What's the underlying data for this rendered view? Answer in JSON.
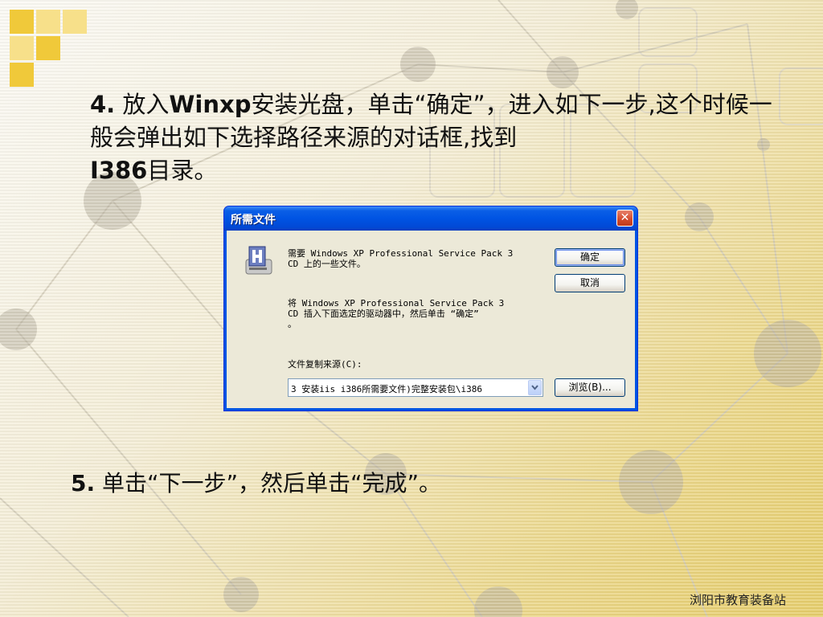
{
  "slide": {
    "step4": {
      "num": "4.",
      "t1": " 放入",
      "t2": "Winxp",
      "t3": "安装光盘，单击“确定”，进入如下一步,这个时候一般会弹出如下选择路径来源的对话框,找到",
      "t4": "I386",
      "t5": "目录。"
    },
    "step5": {
      "num": "5.",
      "text": " 单击“下一步”，然后单击“完成”。"
    },
    "footer": "浏阳市教育装备站"
  },
  "dialog": {
    "title": "所需文件",
    "close": "✕",
    "message1": "需要 Windows XP Professional Service Pack 3\nCD 上的一些文件。",
    "message2": "将 Windows XP Professional Service Pack 3\nCD 插入下面选定的驱动器中，然后单击 “确定”\n。",
    "source_label": "文件复制来源(C):",
    "source_value": "3 安装iis i386所需要文件)完整安装包\\i386",
    "ok_label": "确定",
    "cancel_label": "取消",
    "browse_label": "浏览(B)..."
  },
  "colors": {
    "tile_dark": "#f0c93a",
    "tile_light": "#f7e08a",
    "titlebar": "#0054e3",
    "dialog_bg": "#ece9d8"
  }
}
